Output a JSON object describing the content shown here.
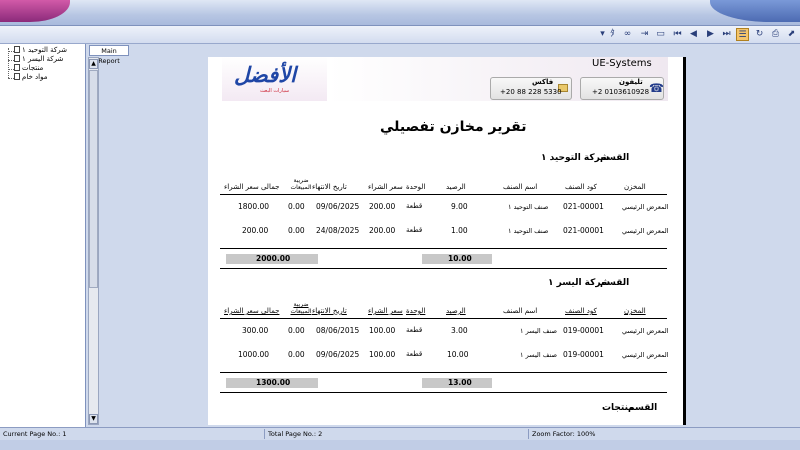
{
  "toolbar": {
    "buttons": [
      "dropdown",
      "find",
      "binoculars",
      "export",
      "print-layout",
      "first",
      "prev",
      "next",
      "last",
      "group-tree",
      "refresh",
      "print",
      "options"
    ]
  },
  "tree": {
    "items": [
      "شركة التوحيد ١",
      "شركة اليسر ١",
      "منتجات",
      "مواد خام"
    ]
  },
  "tabs": {
    "main_report": "Main Report"
  },
  "report": {
    "company_name": "UE-Systems",
    "logo_text": "الأفضل",
    "logo_sub": "سيارات البعث",
    "phone_label": "تليفون",
    "phone_value": "+2 0103610928",
    "fax_label": "فاكس",
    "fax_value": "+20 88 228 5330",
    "title": "تقرير مخازن تفصيلي",
    "section_label": "القسم",
    "columns": {
      "store": "المخزن",
      "code": "كود الصنف",
      "name": "اسم الصنف",
      "balance": "الرصيد",
      "unit": "الوحدة",
      "price": "سعر الشراء",
      "expiry": "تاريخ الانتهاء",
      "tax": "ضريبة المبيعات",
      "total": "جمالى سعر الشراء"
    },
    "sections": [
      {
        "name": "شركة التوحيد ١",
        "rows": [
          {
            "store": "المعرض الرئيسي",
            "code": "021-00001",
            "name": "صنف التوحيد ١",
            "balance": "9.00",
            "unit": "قطعة",
            "price": "200.00",
            "expiry": "09/06/2025",
            "tax": "0.00",
            "total": "1800.00"
          },
          {
            "store": "المعرض الرئيسي",
            "code": "021-00001",
            "name": "صنف التوحيد ١",
            "balance": "1.00",
            "unit": "قطعة",
            "price": "200.00",
            "expiry": "24/08/2025",
            "tax": "0.00",
            "total": "200.00"
          }
        ],
        "sum_total": "2000.00",
        "sum_balance": "10.00"
      },
      {
        "name": "شركة اليسر ١",
        "rows": [
          {
            "store": "المعرض الرئيسي",
            "code": "019-00001",
            "name": "صنف اليسر ١",
            "balance": "3.00",
            "unit": "قطعة",
            "price": "100.00",
            "expiry": "08/06/2015",
            "tax": "0.00",
            "total": "300.00"
          },
          {
            "store": "المعرض الرئيسي",
            "code": "019-00001",
            "name": "صنف اليسر ١",
            "balance": "10.00",
            "unit": "قطعة",
            "price": "100.00",
            "expiry": "09/06/2025",
            "tax": "0.00",
            "total": "1000.00"
          }
        ],
        "sum_total": "1300.00",
        "sum_balance": "13.00"
      },
      {
        "name": "منتجات"
      }
    ]
  },
  "status": {
    "current_page": "Current Page No.: 1",
    "total_page": "Total Page No.: 2",
    "zoom": "Zoom Factor: 100%"
  }
}
